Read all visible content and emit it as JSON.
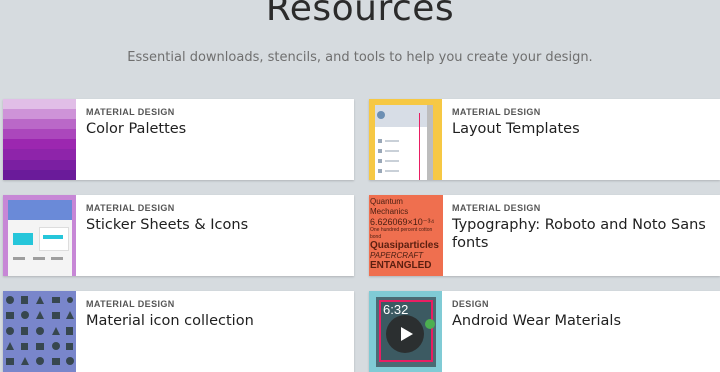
{
  "page": {
    "title": "Resources",
    "subtitle": "Essential downloads, stencils, and tools to help you create your design."
  },
  "cards": [
    {
      "category": "MATERIAL DESIGN",
      "title": "Color Palettes",
      "thumb_color": "#9c27b0"
    },
    {
      "category": "MATERIAL DESIGN",
      "title": "Layout Templates",
      "thumb_color": "#f6c844"
    },
    {
      "category": "MATERIAL DESIGN",
      "title": "Sticker Sheets & Icons",
      "thumb_color": "#c787d6"
    },
    {
      "category": "MATERIAL DESIGN",
      "title": "Typography: Roboto and Noto Sans fonts",
      "thumb_color": "#ef6f4f",
      "thumb_text": [
        "Quantum Mechanics",
        "6.626069×10⁻³⁴",
        "One hundred percent cotton bond",
        "Quasiparticles",
        "PAPERCRAFT",
        "ENTANGLED"
      ]
    },
    {
      "category": "MATERIAL DESIGN",
      "title": "Material icon collection",
      "thumb_color": "#7986cb"
    },
    {
      "category": "DESIGN",
      "title": "Android Wear Materials",
      "thumb_color": "#80cbd5",
      "thumb_text": [
        "6:32"
      ]
    }
  ]
}
